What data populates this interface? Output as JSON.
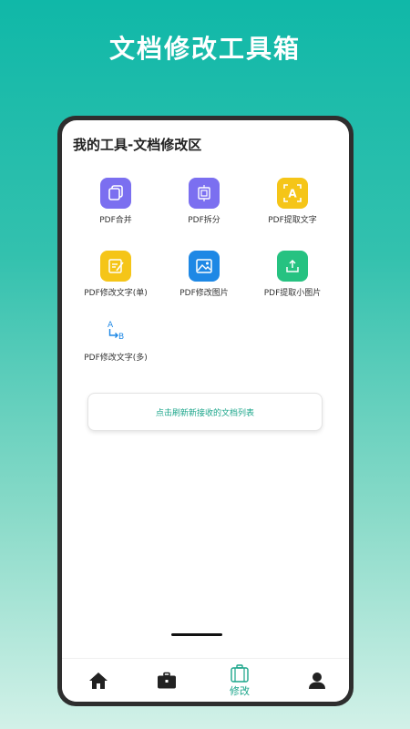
{
  "promo": {
    "title": "文档修改工具箱"
  },
  "screen": {
    "title": "我的工具-文档修改区"
  },
  "tools": [
    {
      "label": "PDF合并",
      "icon": "pdf-merge-icon",
      "color": "#7b6ff0"
    },
    {
      "label": "PDF拆分",
      "icon": "pdf-split-icon",
      "color": "#7b6ff0"
    },
    {
      "label": "PDF提取文字",
      "icon": "pdf-extract-text-icon",
      "color": "#f5c518"
    },
    {
      "label": "PDF修改文字(单)",
      "icon": "pdf-edit-text-single-icon",
      "color": "#f5c518"
    },
    {
      "label": "PDF修改图片",
      "icon": "pdf-edit-image-icon",
      "color": "#1e88e5"
    },
    {
      "label": "PDF提取小图片",
      "icon": "pdf-extract-image-icon",
      "color": "#26c281"
    },
    {
      "label": "PDF修改文字(多)",
      "icon": "pdf-edit-text-multi-icon",
      "color": "#1e88e5"
    }
  ],
  "refresh_button": {
    "label": "点击刷新新接收的文档列表"
  },
  "tabbar": {
    "active_label": "修改",
    "accent": "#1aa58a",
    "items": [
      "home-icon",
      "toolbox-icon",
      "edit-icon",
      "profile-icon"
    ]
  }
}
